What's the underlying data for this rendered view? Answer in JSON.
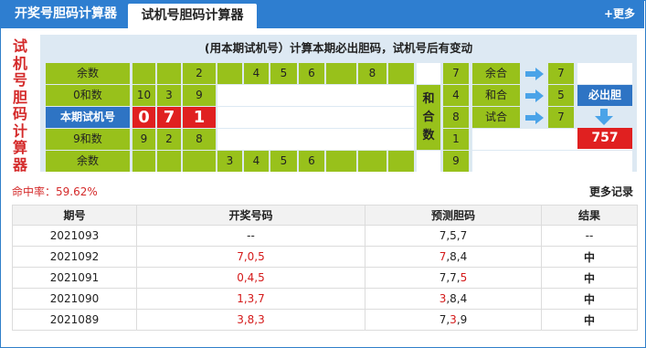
{
  "tabs": [
    {
      "label": "开奖号胆码计算器"
    },
    {
      "label": "试机号胆码计算器"
    }
  ],
  "more_link": "+更多",
  "side_title": [
    "试",
    "机",
    "号",
    "胆",
    "码",
    "计",
    "算",
    "器"
  ],
  "notice": "(用本期试机号）计算本期必出胆码，试机号后有变动",
  "grid": {
    "row1": {
      "label": "余数",
      "cells": [
        "",
        "",
        "2",
        "",
        "4",
        "5",
        "6",
        "",
        "8",
        ""
      ]
    },
    "row2": {
      "label": "0和数",
      "cells": [
        "10",
        "3",
        "9"
      ]
    },
    "row3": {
      "label": "本期试机号",
      "cells": [
        "0",
        "7",
        "1"
      ]
    },
    "row4": {
      "label": "9和数",
      "cells": [
        "9",
        "2",
        "8"
      ]
    },
    "row5": {
      "label": "余数",
      "cells": [
        "",
        "",
        "",
        "3",
        "4",
        "5",
        "6",
        "",
        "",
        ""
      ]
    },
    "hehe": [
      "和",
      "合",
      "数"
    ],
    "col_values": [
      "7",
      "4",
      "8",
      "1",
      "9"
    ],
    "right_labels": [
      "余合",
      "和合",
      "试合"
    ],
    "right_values": [
      "7",
      "5",
      "7"
    ],
    "must_label": "必出胆",
    "result": "757"
  },
  "hit_rate": "命中率：59.62%",
  "more_records": "更多记录",
  "table": {
    "headers": [
      "期号",
      "开奖号码",
      "预测胆码",
      "结果"
    ],
    "rows": [
      {
        "issue": "2021093",
        "draw": [
          {
            "t": "--",
            "hit": false
          }
        ],
        "pred": [
          {
            "t": "7",
            "hit": false
          },
          {
            "t": ",5,7",
            "hit": false
          }
        ],
        "result": "--",
        "win": false
      },
      {
        "issue": "2021092",
        "draw": [
          {
            "t": "7,0,5",
            "hit": true
          }
        ],
        "pred": [
          {
            "t": "7",
            "hit": true
          },
          {
            "t": ",8,4",
            "hit": false
          }
        ],
        "result": "中",
        "win": true
      },
      {
        "issue": "2021091",
        "draw": [
          {
            "t": "0,4,5",
            "hit": true
          }
        ],
        "pred": [
          {
            "t": "7,7,",
            "hit": false
          },
          {
            "t": "5",
            "hit": true
          }
        ],
        "result": "中",
        "win": true
      },
      {
        "issue": "2021090",
        "draw": [
          {
            "t": "1,3,7",
            "hit": true
          }
        ],
        "pred": [
          {
            "t": "3",
            "hit": true
          },
          {
            "t": ",8,4",
            "hit": false
          }
        ],
        "result": "中",
        "win": true
      },
      {
        "issue": "2021089",
        "draw": [
          {
            "t": "3,8,3",
            "hit": true
          }
        ],
        "pred": [
          {
            "t": "7,",
            "hit": false
          },
          {
            "t": "3",
            "hit": true
          },
          {
            "t": ",9",
            "hit": false
          }
        ],
        "result": "中",
        "win": true
      }
    ]
  }
}
